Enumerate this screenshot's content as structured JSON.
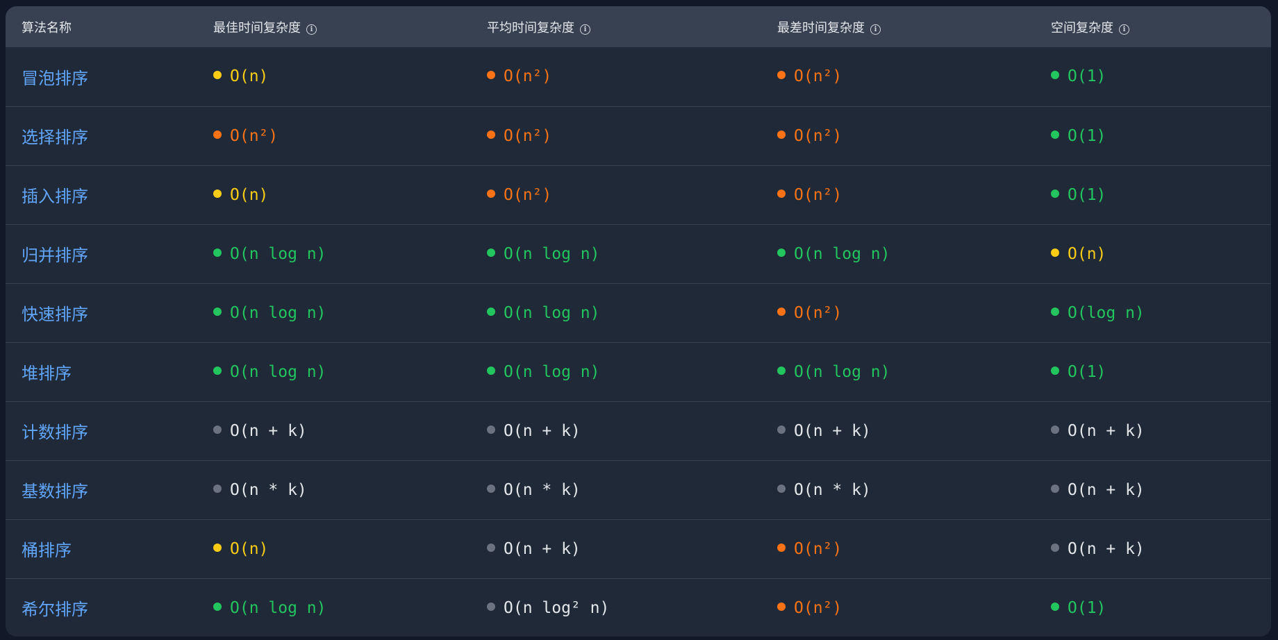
{
  "colors": {
    "page_bg": "#111827",
    "panel_bg": "#1f2937",
    "header_bg": "#374151",
    "row_border": "#374151",
    "name_blue": "#60a5fa",
    "green": "#22c55e",
    "yellow": "#facc15",
    "orange": "#f97316",
    "gray": "#6b7280",
    "gray_text": "#e5e7eb"
  },
  "table": {
    "headers": [
      {
        "label": "算法名称",
        "info_icon": false
      },
      {
        "label": "最佳时间复杂度",
        "info_icon": true
      },
      {
        "label": "平均时间复杂度",
        "info_icon": true
      },
      {
        "label": "最差时间复杂度",
        "info_icon": true
      },
      {
        "label": "空间复杂度",
        "info_icon": true
      }
    ],
    "rows": [
      {
        "name": "冒泡排序",
        "cells": [
          {
            "text": "O(n)",
            "level": "yellow"
          },
          {
            "text": "O(n²)",
            "level": "orange"
          },
          {
            "text": "O(n²)",
            "level": "orange"
          },
          {
            "text": "O(1)",
            "level": "green"
          }
        ]
      },
      {
        "name": "选择排序",
        "cells": [
          {
            "text": "O(n²)",
            "level": "orange"
          },
          {
            "text": "O(n²)",
            "level": "orange"
          },
          {
            "text": "O(n²)",
            "level": "orange"
          },
          {
            "text": "O(1)",
            "level": "green"
          }
        ]
      },
      {
        "name": "插入排序",
        "cells": [
          {
            "text": "O(n)",
            "level": "yellow"
          },
          {
            "text": "O(n²)",
            "level": "orange"
          },
          {
            "text": "O(n²)",
            "level": "orange"
          },
          {
            "text": "O(1)",
            "level": "green"
          }
        ]
      },
      {
        "name": "归并排序",
        "cells": [
          {
            "text": "O(n log n)",
            "level": "green"
          },
          {
            "text": "O(n log n)",
            "level": "green"
          },
          {
            "text": "O(n log n)",
            "level": "green"
          },
          {
            "text": "O(n)",
            "level": "yellow"
          }
        ]
      },
      {
        "name": "快速排序",
        "cells": [
          {
            "text": "O(n log n)",
            "level": "green"
          },
          {
            "text": "O(n log n)",
            "level": "green"
          },
          {
            "text": "O(n²)",
            "level": "orange"
          },
          {
            "text": "O(log n)",
            "level": "green"
          }
        ]
      },
      {
        "name": "堆排序",
        "cells": [
          {
            "text": "O(n log n)",
            "level": "green"
          },
          {
            "text": "O(n log n)",
            "level": "green"
          },
          {
            "text": "O(n log n)",
            "level": "green"
          },
          {
            "text": "O(1)",
            "level": "green"
          }
        ]
      },
      {
        "name": "计数排序",
        "cells": [
          {
            "text": "O(n + k)",
            "level": "gray"
          },
          {
            "text": "O(n + k)",
            "level": "gray"
          },
          {
            "text": "O(n + k)",
            "level": "gray"
          },
          {
            "text": "O(n + k)",
            "level": "gray"
          }
        ]
      },
      {
        "name": "基数排序",
        "cells": [
          {
            "text": "O(n * k)",
            "level": "gray"
          },
          {
            "text": "O(n * k)",
            "level": "gray"
          },
          {
            "text": "O(n * k)",
            "level": "gray"
          },
          {
            "text": "O(n + k)",
            "level": "gray"
          }
        ]
      },
      {
        "name": "桶排序",
        "cells": [
          {
            "text": "O(n)",
            "level": "yellow"
          },
          {
            "text": "O(n + k)",
            "level": "gray"
          },
          {
            "text": "O(n²)",
            "level": "orange"
          },
          {
            "text": "O(n + k)",
            "level": "gray"
          }
        ]
      },
      {
        "name": "希尔排序",
        "cells": [
          {
            "text": "O(n log n)",
            "level": "green"
          },
          {
            "text": "O(n log² n)",
            "level": "gray"
          },
          {
            "text": "O(n²)",
            "level": "orange"
          },
          {
            "text": "O(1)",
            "level": "green"
          }
        ]
      }
    ]
  }
}
